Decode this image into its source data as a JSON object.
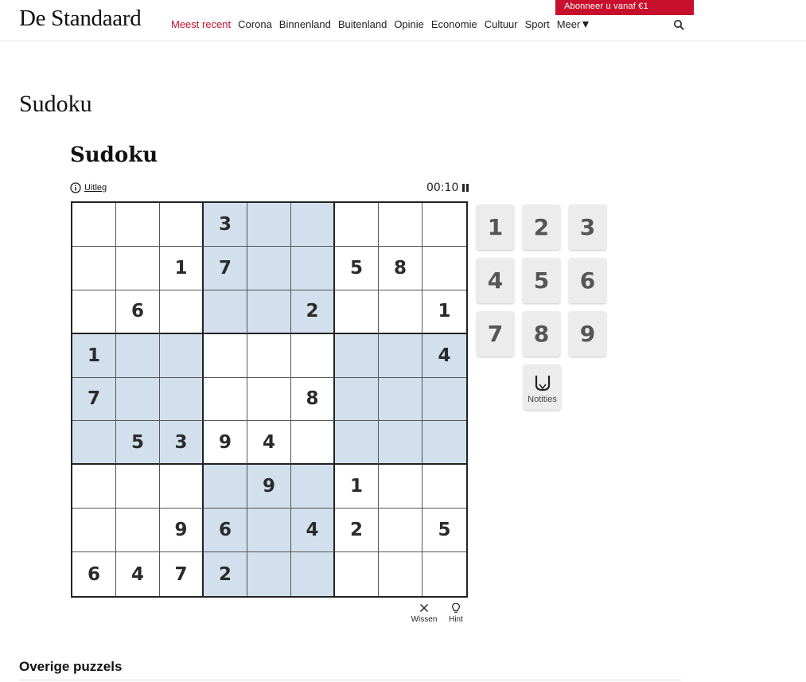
{
  "header": {
    "logo": "De Standaard",
    "nav": [
      {
        "label": "Meest recent",
        "active": true
      },
      {
        "label": "Corona",
        "active": false
      },
      {
        "label": "Binnenland",
        "active": false
      },
      {
        "label": "Buitenland",
        "active": false
      },
      {
        "label": "Opinie",
        "active": false
      },
      {
        "label": "Economie",
        "active": false
      },
      {
        "label": "Cultuur",
        "active": false
      },
      {
        "label": "Sport",
        "active": false
      }
    ],
    "more_label": "Meer",
    "subscribe_label": "Abonneer u vanaf €1",
    "search_icon": "search-icon"
  },
  "page_title": "Sudoku",
  "game": {
    "title": "Sudoku",
    "uitleg_label": "Uitleg",
    "timer": "00:10",
    "grid": [
      [
        "",
        "",
        "",
        "3",
        "",
        "",
        "",
        "",
        ""
      ],
      [
        "",
        "",
        "1",
        "7",
        "",
        "",
        "5",
        "8",
        ""
      ],
      [
        "",
        "6",
        "",
        "",
        "",
        "2",
        "",
        "",
        "1"
      ],
      [
        "1",
        "",
        "",
        "",
        "",
        "",
        "",
        "",
        "4"
      ],
      [
        "7",
        "",
        "",
        "",
        "",
        "8",
        "",
        "",
        ""
      ],
      [
        "",
        "5",
        "3",
        "9",
        "4",
        "",
        "",
        "",
        ""
      ],
      [
        "",
        "",
        "",
        "",
        "9",
        "",
        "1",
        "",
        ""
      ],
      [
        "",
        "",
        "9",
        "6",
        "",
        "4",
        "2",
        "",
        "5"
      ],
      [
        "6",
        "4",
        "7",
        "2",
        "",
        "",
        "",
        "",
        ""
      ]
    ],
    "highlighted_boxes": [
      [
        0,
        1
      ],
      [
        1,
        0
      ],
      [
        1,
        2
      ],
      [
        2,
        1
      ]
    ],
    "keypad": [
      "1",
      "2",
      "3",
      "4",
      "5",
      "6",
      "7",
      "8",
      "9"
    ],
    "notities_label": "Notities",
    "wissen_label": "Wissen",
    "hint_label": "Hint"
  },
  "colors": {
    "brand_red": "#c8102e",
    "highlight": "#d1e0ec",
    "key_bg": "#ececec"
  },
  "footer": {
    "other_title": "Overige puzzels"
  }
}
